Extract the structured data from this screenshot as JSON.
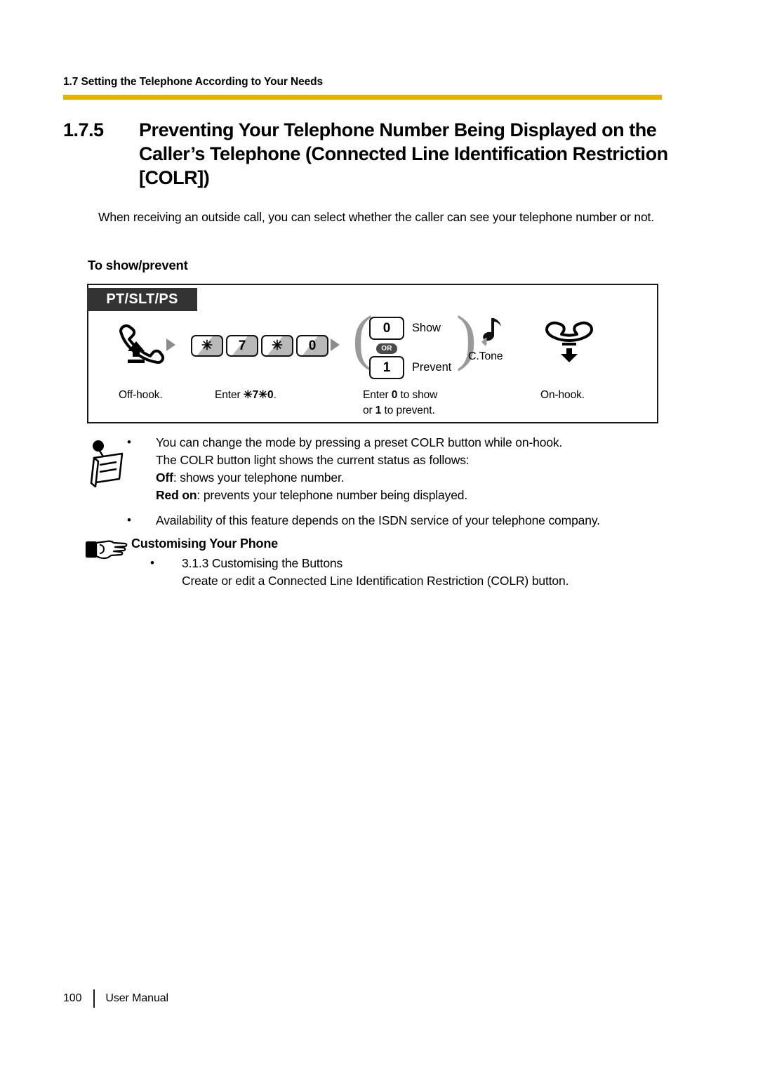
{
  "header": {
    "running_title": "1.7 Setting the Telephone According to Your Needs",
    "rule_color": "#E0B400"
  },
  "section": {
    "number": "1.7.5",
    "title": "Preventing Your Telephone Number Being Displayed on the Caller’s Telephone (Connected Line Identification Restriction [COLR])"
  },
  "intro": "When receiving an outside call, you can select whether the caller can see your telephone number or not.",
  "subheading": "To show/prevent",
  "procedure": {
    "tag": "PT/SLT/PS",
    "tag_bg": "#333333",
    "steps": [
      {
        "icon": "offhook-handset-icon",
        "caption": "Off-hook."
      },
      {
        "icon": "keypad-icon",
        "keys": [
          "✳",
          "7",
          "✳",
          "0"
        ],
        "caption_prefix": "Enter ",
        "caption_code": "✳7✳0",
        "caption_suffix": "."
      },
      {
        "icon": "choice-icon",
        "or_badge": "OR",
        "options": [
          {
            "key": "0",
            "label": "Show"
          },
          {
            "key": "1",
            "label": "Prevent"
          }
        ],
        "caption_line1_a": "Enter ",
        "caption_line1_b": "0",
        "caption_line1_c": " to show",
        "caption_line2_a": "or ",
        "caption_line2_b": "1",
        "caption_line2_c": " to prevent."
      },
      {
        "icon": "confirmation-tone-icon",
        "label": "C.Tone"
      },
      {
        "icon": "onhook-handset-icon",
        "caption": "On-hook."
      }
    ]
  },
  "note": {
    "icon": "note-pushpin-icon",
    "items": [
      {
        "lines": [
          {
            "text": "You can change the mode by pressing a preset COLR button while on-hook."
          },
          {
            "text": "The COLR button light shows the current status as follows:"
          },
          {
            "bold": "Off",
            "text": ": shows your telephone number."
          },
          {
            "bold": "Red on",
            "text": ": prevents your telephone number being displayed."
          }
        ]
      },
      {
        "lines": [
          {
            "text": "Availability of this feature depends on the ISDN service of your telephone company."
          }
        ]
      }
    ]
  },
  "customising": {
    "icon": "pointing-hand-icon",
    "title": "Customising Your Phone",
    "items": [
      {
        "line1": "3.1.3 Customising the Buttons",
        "line2": "Create or edit a Connected Line Identification Restriction (COLR) button."
      }
    ]
  },
  "footer": {
    "page_number": "100",
    "manual_label": "User Manual"
  }
}
